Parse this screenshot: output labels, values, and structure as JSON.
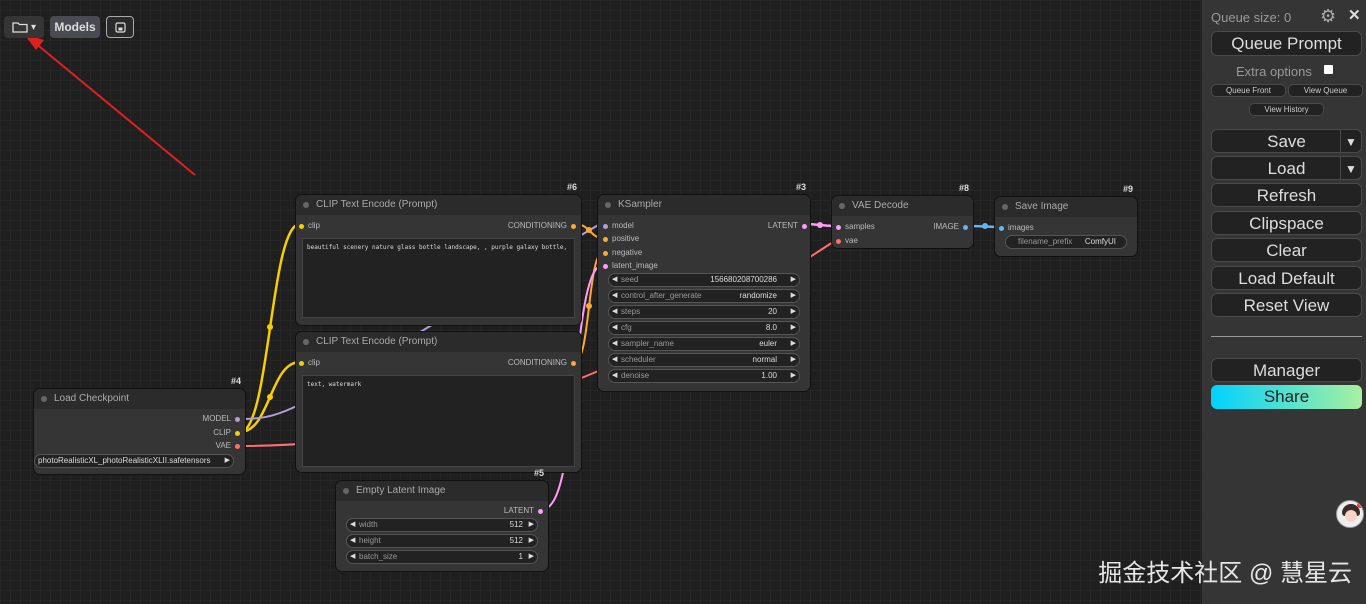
{
  "toolbar": {
    "folder_icon": "folder-icon",
    "dropdown_arrow": "▾",
    "models_label": "Models",
    "save_icon": "save-icon"
  },
  "nodes": {
    "clip_pos": {
      "id": "#6",
      "title": "CLIP Text Encode (Prompt)",
      "input": "clip",
      "output": "CONDITIONING",
      "text": "beautiful scenery nature glass bottle landscape, , purple galaxy bottle,"
    },
    "clip_neg": {
      "id": "",
      "title": "CLIP Text Encode (Prompt)",
      "input": "clip",
      "output": "CONDITIONING",
      "text": "text, watermark"
    },
    "ksampler": {
      "id": "#3",
      "title": "KSampler",
      "inputs": [
        "model",
        "positive",
        "negative",
        "latent_image"
      ],
      "output": "LATENT",
      "widgets": [
        {
          "label": "seed",
          "value": "156680208700286"
        },
        {
          "label": "control_after_generate",
          "value": "randomize"
        },
        {
          "label": "steps",
          "value": "20"
        },
        {
          "label": "cfg",
          "value": "8.0"
        },
        {
          "label": "sampler_name",
          "value": "euler"
        },
        {
          "label": "scheduler",
          "value": "normal"
        },
        {
          "label": "denoise",
          "value": "1.00"
        }
      ]
    },
    "vae_decode": {
      "id": "#8",
      "title": "VAE Decode",
      "inputs": [
        "samples",
        "vae"
      ],
      "output": "IMAGE"
    },
    "save_image": {
      "id": "#9",
      "title": "Save Image",
      "input": "images",
      "widget_label": "filename_prefix",
      "widget_value": "ComfyUI"
    },
    "load_checkpoint": {
      "id": "#4",
      "title": "Load Checkpoint",
      "outputs": [
        "MODEL",
        "CLIP",
        "VAE"
      ],
      "widget_value": "photoRealisticXL_photoRealisticXLII.safetensors"
    },
    "empty_latent": {
      "id": "#5",
      "title": "Empty Latent Image",
      "output": "LATENT",
      "widgets": [
        {
          "label": "width",
          "value": "512"
        },
        {
          "label": "height",
          "value": "512"
        },
        {
          "label": "batch_size",
          "value": "1"
        }
      ]
    }
  },
  "menu": {
    "queue_size": "Queue size: 0",
    "queue_prompt": "Queue Prompt",
    "extra_options": "Extra options",
    "queue_front": "Queue Front",
    "view_queue": "View Queue",
    "view_history": "View History",
    "save": "Save",
    "load": "Load",
    "refresh": "Refresh",
    "clipspace": "Clipspace",
    "clear": "Clear",
    "load_default": "Load Default",
    "reset_view": "Reset View",
    "manager": "Manager",
    "share": "Share",
    "dropdown_arrow": "▼",
    "close": "✕"
  },
  "watermark": "掘金技术社区 @ 慧星云",
  "colors": {
    "clip": "#f5d000",
    "model": "#b39ddb",
    "vae": "#ff6e6e",
    "conditioning": "#ffa931",
    "latent": "#ff9cf9",
    "image": "#64b5f6",
    "arrow": "#e02020"
  }
}
